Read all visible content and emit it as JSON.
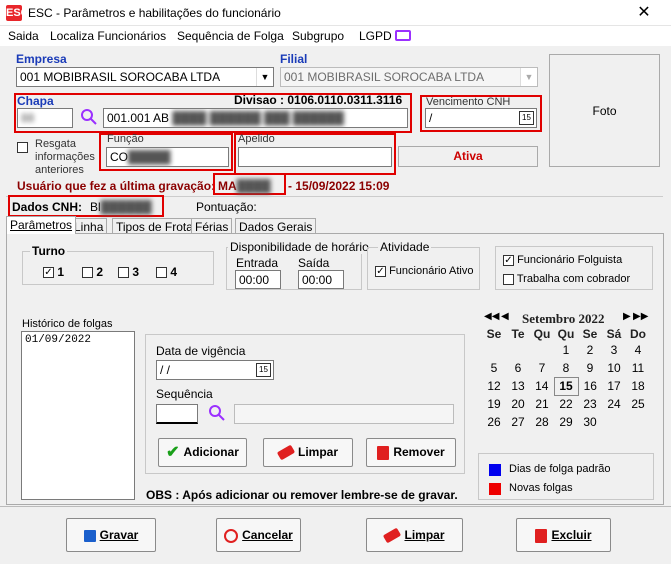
{
  "window": {
    "title": "ESC - Parâmetros e habilitações do funcionário",
    "logo": "ESC"
  },
  "menu": [
    "Saida",
    "Localiza Funcionários",
    "Sequência de Folga",
    "Subgrupo",
    "LGPD"
  ],
  "empresa": {
    "label": "Empresa",
    "value": "001 MOBIBRASIL SOROCABA LTDA"
  },
  "filial": {
    "label": "Filial",
    "value": "001 MOBIBRASIL SOROCABA LTDA"
  },
  "foto": {
    "label": "Foto"
  },
  "chapa": {
    "label": "Chapa",
    "code": "88",
    "name": "001.001 AB"
  },
  "divisao": "Divisao : 0106.0110.0311.3116",
  "vencimento": {
    "label": "Vencimento  CNH",
    "value": "/"
  },
  "resgata": {
    "line1": "Resgata",
    "line2": "informações",
    "line3": "anteriores"
  },
  "funcao": {
    "label": "Função",
    "value": "CO"
  },
  "apelido": {
    "label": "Apelido",
    "value": ""
  },
  "status": {
    "label": "Ativa",
    "color": "#cc0000"
  },
  "ultima": {
    "label": "Usuário que fez a última gravação:",
    "user": "MA",
    "date": "15/09/2022 15:09"
  },
  "cnh": {
    "label": "Dados CNH:",
    "value": "Bl"
  },
  "pontuacao": {
    "label": "Pontuação:"
  },
  "tabs": [
    "Parâmetros",
    "Linha",
    "Tipos de Frota",
    "Férias",
    "Dados Gerais"
  ],
  "turno": {
    "label": "Turno",
    "options": [
      {
        "label": "1",
        "checked": true
      },
      {
        "label": "2",
        "checked": false
      },
      {
        "label": "3",
        "checked": false
      },
      {
        "label": "4",
        "checked": false
      }
    ]
  },
  "disponibilidade": {
    "label": "Disponibilidade de horário",
    "entrada_label": "Entrada",
    "entrada": "00:00",
    "saida_label": "Saída",
    "saida": "00:00"
  },
  "atividade": {
    "label": "Atividade",
    "ativo": "Funcionário Ativo",
    "ativo_checked": true
  },
  "folguista": {
    "label": "Funcionário Folguista",
    "checked": true
  },
  "cobrador": {
    "label": "Trabalha com cobrador",
    "checked": false
  },
  "historico": {
    "label": "Histórico de folgas",
    "items": [
      "01/09/2022"
    ]
  },
  "vigencia": {
    "label": "Data de vigência",
    "value": " / /"
  },
  "sequencia": {
    "label": "Sequência"
  },
  "buttons": {
    "adicionar": "Adicionar",
    "limpar": "Limpar",
    "remover": "Remover"
  },
  "obs": "OBS : Após adicionar ou  remover lembre-se de gravar.",
  "calendar": {
    "month": "Setembro 2022",
    "days": [
      "Se",
      "Te",
      "Qu",
      "Qu",
      "Se",
      "Sá",
      "Do"
    ],
    "weeks": [
      [
        "",
        "",
        "",
        "1",
        "2",
        "3",
        "4"
      ],
      [
        "5",
        "6",
        "7",
        "8",
        "9",
        "10",
        "11"
      ],
      [
        "12",
        "13",
        "14",
        "15",
        "16",
        "17",
        "18"
      ],
      [
        "19",
        "20",
        "21",
        "22",
        "23",
        "24",
        "25"
      ],
      [
        "26",
        "27",
        "28",
        "29",
        "30",
        "",
        ""
      ]
    ],
    "today": "15"
  },
  "legend": [
    {
      "label": "Dias de folga padrão",
      "color": "#0000ee"
    },
    {
      "label": "Novas folgas",
      "color": "#ee0000"
    }
  ],
  "footer": {
    "gravar": "Gravar",
    "cancelar": "Cancelar",
    "limpar": "Limpar",
    "excluir": "Excluir"
  }
}
